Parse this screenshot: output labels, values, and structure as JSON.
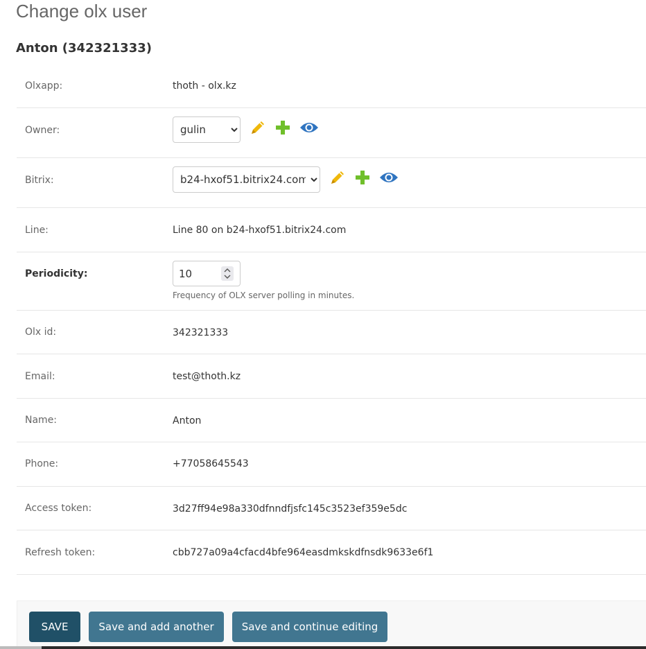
{
  "page": {
    "title": "Change olx user",
    "object_title": "Anton (342321333)"
  },
  "fields": {
    "olxapp": {
      "label": "Olxapp:",
      "value": "thoth - olx.kz"
    },
    "owner": {
      "label": "Owner:",
      "selected": "gulin",
      "icons": [
        "edit-icon",
        "add-icon",
        "view-icon"
      ]
    },
    "bitrix": {
      "label": "Bitrix:",
      "selected": "b24-hxof51.bitrix24.com",
      "icons": [
        "edit-icon",
        "add-icon",
        "view-icon"
      ]
    },
    "line": {
      "label": "Line:",
      "value": "Line 80 on b24-hxof51.bitrix24.com"
    },
    "periodicity": {
      "label": "Periodicity:",
      "value": "10",
      "help": "Frequency of OLX server polling in minutes."
    },
    "olx_id": {
      "label": "Olx id:",
      "value": "342321333"
    },
    "email": {
      "label": "Email:",
      "value": "test@thoth.kz"
    },
    "name": {
      "label": "Name:",
      "value": "Anton"
    },
    "phone": {
      "label": "Phone:",
      "value": "+77058645543"
    },
    "access_token": {
      "label": "Access token:",
      "value": "3d27ff94e98a330dfnndfjsfc145c3523ef359e5dc"
    },
    "refresh_token": {
      "label": "Refresh token:",
      "value": "cbb727a09a4cfacd4bfe964easdmkskdfnsdk9633e6f1"
    }
  },
  "buttons": {
    "save": "SAVE",
    "save_add": "Save and add another",
    "save_continue": "Save and continue editing"
  },
  "colors": {
    "link": "#447e9b",
    "edit_icon": "#efb80b",
    "add_icon": "#70bf2b",
    "view_icon": "#2f74c0",
    "button": "#417690",
    "button_default": "#205067"
  }
}
